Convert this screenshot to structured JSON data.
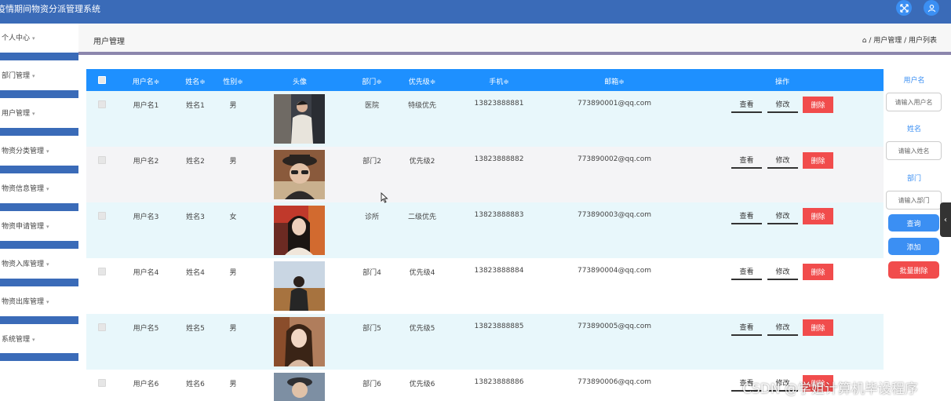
{
  "app": {
    "title": "疫情期间物资分派管理系统",
    "user_icon": "user-icon",
    "fullscreen_icon": "fullscreen-icon"
  },
  "sidebar": {
    "items": [
      {
        "label": "个人中心"
      },
      {
        "label": "部门管理"
      },
      {
        "label": "用户管理"
      },
      {
        "label": "物资分类管理"
      },
      {
        "label": "物资信息管理"
      },
      {
        "label": "物资申请管理"
      },
      {
        "label": "物资入库管理"
      },
      {
        "label": "物资出库管理"
      },
      {
        "label": "系统管理"
      }
    ],
    "caret": "▾"
  },
  "header": {
    "page_title": "用户管理",
    "breadcrumb": "⌂ / 用户管理 / 用户列表"
  },
  "table": {
    "columns": [
      "用户名≑",
      "姓名≑",
      "性别≑",
      "头像",
      "部门≑",
      "优先级≑",
      "手机≑",
      "邮箱≑",
      "操作"
    ],
    "rows": [
      {
        "username": "用户名1",
        "name": "姓名1",
        "gender": "男",
        "dept": "医院",
        "priority": "特级优先",
        "phone": "13823888881",
        "email": "773890001@qq.com"
      },
      {
        "username": "用户名2",
        "name": "姓名2",
        "gender": "男",
        "dept": "部门2",
        "priority": "优先级2",
        "phone": "13823888882",
        "email": "773890002@qq.com"
      },
      {
        "username": "用户名3",
        "name": "姓名3",
        "gender": "女",
        "dept": "诊所",
        "priority": "二级优先",
        "phone": "13823888883",
        "email": "773890003@qq.com"
      },
      {
        "username": "用户名4",
        "name": "姓名4",
        "gender": "男",
        "dept": "部门4",
        "priority": "优先级4",
        "phone": "13823888884",
        "email": "773890004@qq.com"
      },
      {
        "username": "用户名5",
        "name": "姓名5",
        "gender": "男",
        "dept": "部门5",
        "priority": "优先级5",
        "phone": "13823888885",
        "email": "773890005@qq.com"
      },
      {
        "username": "用户名6",
        "name": "姓名6",
        "gender": "男",
        "dept": "部门6",
        "priority": "优先级6",
        "phone": "13823888886",
        "email": "773890006@qq.com"
      }
    ],
    "actions": {
      "view": "查看",
      "edit": "修改",
      "delete": "删除"
    }
  },
  "filters": {
    "username_label": "用户名",
    "username_placeholder": "请输入用户名",
    "name_label": "姓名",
    "name_placeholder": "请输入姓名",
    "dept_label": "部门",
    "dept_placeholder": "请输入部门",
    "search_button": "查询",
    "add_button": "添加",
    "batch_delete_button": "批量删除"
  },
  "watermark": "CSDN @学姐计算机毕设程序",
  "colors": {
    "topbar": "#3a6bb8",
    "table_header": "#1e90ff",
    "row_tint": "#e8f7fb",
    "delete": "#f14c4c",
    "primary_button": "#3b8ff3"
  }
}
